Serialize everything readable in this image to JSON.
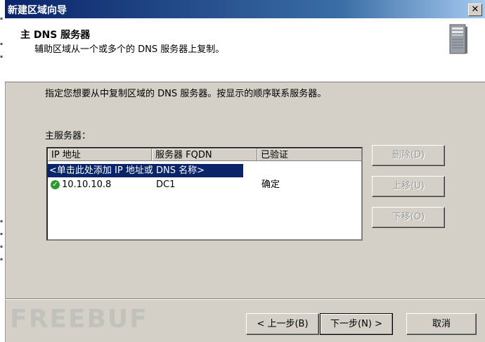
{
  "window": {
    "title": "新建区域向导",
    "close_label": "✕"
  },
  "header": {
    "title": "主 DNS 服务器",
    "subtitle": "辅助区域从一个或多个的 DNS 服务器上复制。"
  },
  "instruction": "指定您想要从中复制区域的 DNS 服务器。按显示的顺序联系服务器。",
  "server_list": {
    "label": "主服务器：",
    "columns": [
      "IP 地址",
      "服务器 FQDN",
      "已验证"
    ],
    "add_prompt": "<单击此处添加 IP 地址或 DNS 名称>",
    "rows": [
      {
        "status_icon": "check-icon",
        "ip": "10.10.10.8",
        "fqdn": "DC1",
        "validated": "确定"
      }
    ]
  },
  "side_buttons": {
    "delete": "删除(D)",
    "move_up": "上移(U)",
    "move_down": "下移(O)"
  },
  "footer": {
    "back": "< 上一步(B)",
    "next": "下一步(N) >",
    "cancel": "取消"
  },
  "watermark": "FREEBUF"
}
